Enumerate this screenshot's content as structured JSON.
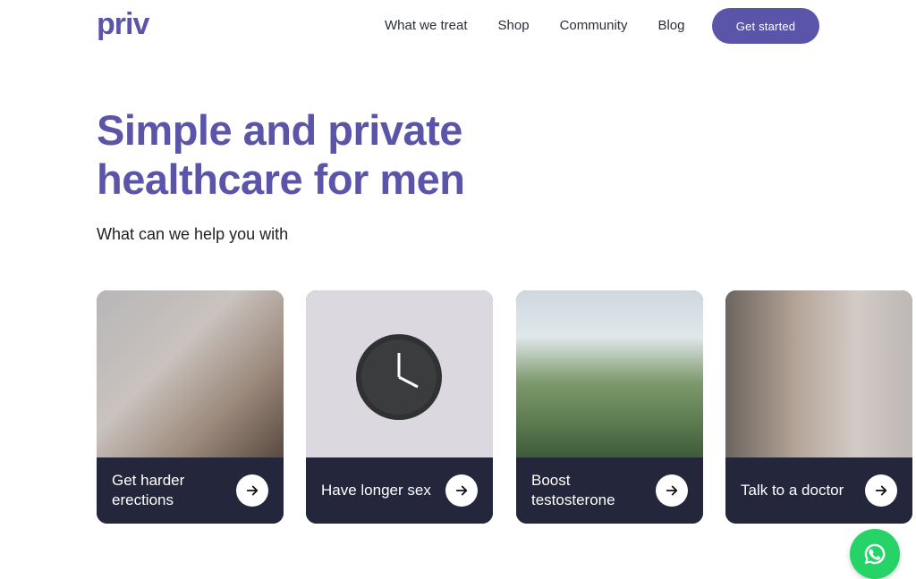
{
  "brand": {
    "logo_text": "priv",
    "brand_color": "#5a55a8"
  },
  "nav": {
    "items": [
      "What we treat",
      "Shop",
      "Community",
      "Blog"
    ],
    "cta_label": "Get started"
  },
  "hero": {
    "title": "Simple and private healthcare for men",
    "subtitle": "What can we help you with"
  },
  "cards": [
    {
      "label": "Get harder erections"
    },
    {
      "label": "Have longer sex"
    },
    {
      "label": "Boost testosterone"
    },
    {
      "label": "Talk to a doctor"
    }
  ],
  "icons": {
    "card_action": "arrow-right-icon",
    "chat_button": "whatsapp-icon"
  },
  "colors": {
    "card_panel": "#24263b",
    "whatsapp": "#25d366"
  }
}
